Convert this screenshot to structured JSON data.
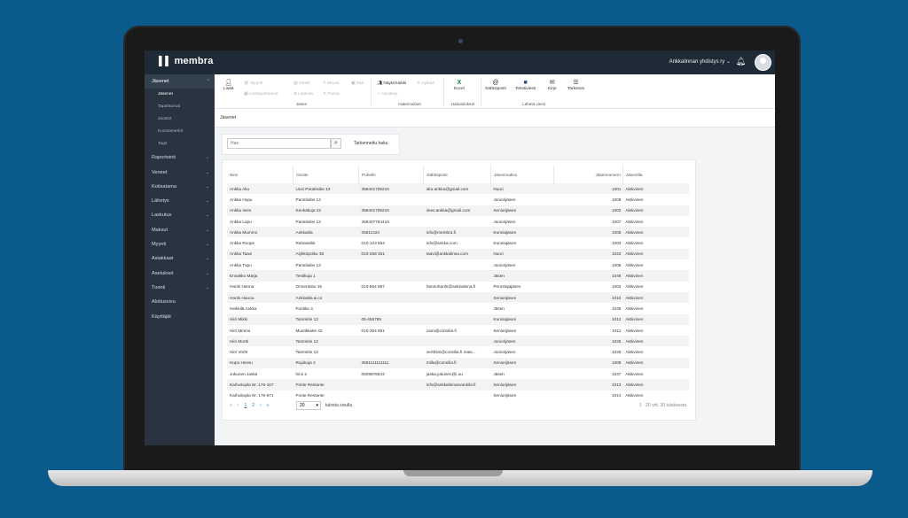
{
  "app": {
    "logo": "membra",
    "org_name": "Ankkalinnan yhdistys ry",
    "org_chevron": "⌄"
  },
  "sidebar": {
    "items": [
      {
        "label": "Jäsenet",
        "active": true,
        "subitems": [
          "Jäsenet",
          "Tapahtumat",
          "Jaostot",
          "Kunniamerkit",
          "Tagit"
        ]
      },
      {
        "label": "Raportointi"
      },
      {
        "label": "Veneet"
      },
      {
        "label": "Kotisatama"
      },
      {
        "label": "Lähetys"
      },
      {
        "label": "Laskutus"
      },
      {
        "label": "Maksut"
      },
      {
        "label": "Myynti"
      },
      {
        "label": "Asiakkaat"
      },
      {
        "label": "Asetukset"
      },
      {
        "label": "Tuonti"
      },
      {
        "label": "Aloitussivu"
      },
      {
        "label": "Käyttäjät"
      }
    ]
  },
  "ribbon": {
    "lisaa": "Lisää",
    "myynti": "Myynti",
    "lisatapahtumat": "Lisätapahtumat",
    "viestit": "Viestit",
    "muuta": "Muuta",
    "sita": "Sitä",
    "laskuta": "Laskuta",
    "poista": "Poista",
    "nayta_kaikki": "Näytä kaikki",
    "hylkaa": "Hylkää",
    "hyvaksy": "Hyväksy",
    "excel": "Excel",
    "sahkoposti": "Sähköposti",
    "tekstiviesti": "Tekstiviesti",
    "kirje": "Kirje",
    "tarkistus": "Tarkistus",
    "groups": {
      "jasen": "Jäsen",
      "hakemukset": "Hakemukset",
      "hakutulokset": "Hakutulokset",
      "laheta_viesti": "Lähetä viesti"
    }
  },
  "breadcrumb": "Jäsenet",
  "search": {
    "placeholder": "Hae",
    "advanced": "Tarkennettu haku"
  },
  "table": {
    "headers": [
      "Nimi",
      "Osoite",
      "Puhelin",
      "Sähköposti",
      "Jäsenmaksu",
      "Jäsennumero",
      "Jäsentila"
    ],
    "rows": [
      [
        "Ankka Aku",
        "Uusi Paratiisitie 13",
        "358401709210",
        "aku.ankka@gmail.com",
        "Nuori",
        "1001",
        "Aktiivinen"
      ],
      [
        "Ankka Hupu",
        "Paratiisitie 13",
        "",
        "",
        "Juniorijäsen",
        "1008",
        "Aktiivinen"
      ],
      [
        "Ankka Iines",
        "Kenkäkuja 22",
        "358401709210",
        "iines.ankka@gmail.com",
        "Seniorijäsen",
        "1002",
        "Aktiivinen"
      ],
      [
        "Ankka Lupu",
        "Paratiisitie 13",
        "358407784416",
        "",
        "Juniorijäsen",
        "1007",
        "Aktiivinen"
      ],
      [
        "Ankka Mummo",
        "Ankkatila",
        "35811324",
        "info@membra.fi",
        "Kunniajäsen",
        "1005",
        "Aktiivinen"
      ],
      [
        "Ankka Roope",
        "Rahasäiliö",
        "010-123 654",
        "info@ankka.com",
        "Kunniajäsen",
        "1003",
        "Aktiivinen"
      ],
      [
        "Ankka Taavi",
        "Alykköpolku 35",
        "010-268 451",
        "taavi@ankkalinna.com",
        "Nuori",
        "1022",
        "Aktiivinen"
      ],
      [
        "Ankka Tupu",
        "Paratiisitie 13",
        "",
        "",
        "Juniorijäsen",
        "1006",
        "Aktiivinen"
      ],
      [
        "Ennakko Marja",
        "Testikuja 1",
        "",
        "",
        "Jäsen",
        "1048",
        "Aktiivinen"
      ],
      [
        "Hanhi Hannu",
        "Onnenkatu 15",
        "010-654 897",
        "hannuhanhi@ankkalinna.fi",
        "Perustajajäsen",
        "1004",
        "Aktiivinen"
      ],
      [
        "Hanhi Hanou",
        "Ankkatila & co",
        "",
        "",
        "Seniorijäsen",
        "1010",
        "Aktiivinen"
      ],
      [
        "Heikkilä Ankka",
        "Postitie 4",
        "",
        "",
        "Jäsen",
        "1049",
        "Aktiivinen"
      ],
      [
        "Hiiri Mikki",
        "Tammitie 12",
        "05-456789",
        "",
        "Kunniajäsen",
        "1012",
        "Aktiivinen"
      ],
      [
        "Hiiri Mimmi",
        "Mustikkatie 42",
        "010-364 851",
        "cami@consilia.fi",
        "Seniorijäsen",
        "1011",
        "Aktiivinen"
      ],
      [
        "Hiiri Mortti",
        "Tammitie 12",
        "",
        "",
        "Juniorijäsen",
        "1025",
        "Aktiivinen"
      ],
      [
        "Hiiri Vertti",
        "Tammitie 12",
        "",
        "vertthiiri@consilia.fi mats...",
        "Juniorijäsen",
        "1026",
        "Aktiivinen"
      ],
      [
        "Hopo Hessu",
        "Rujokuja 4",
        "3581111111111",
        "milla@consilia.fi",
        "Seniorijäsen",
        "1009",
        "Aktiivinen"
      ],
      [
        "Jokunen Jaska",
        "hirvi 2",
        "0509876543",
        "jaska.jokunen@i.uu",
        "Jäsen",
        "1047",
        "Aktiivinen"
      ],
      [
        "Karhukopla Nr. 176-167",
        "Poste Restante",
        "",
        "info@ankkalinnanvankila.fi",
        "Seniorijäsen",
        "1013",
        "Aktiivinen"
      ],
      [
        "Karhukopla Nr. 176-671",
        "Poste Restante",
        "",
        "",
        "Seniorijäsen",
        "1014",
        "Aktiivinen"
      ]
    ]
  },
  "pagination": {
    "page1": "1",
    "page2": "2",
    "per_page": "20",
    "per_page_label": "tulosta sivulla",
    "results": "1 - 20 yht. 30 tuloksesta"
  }
}
